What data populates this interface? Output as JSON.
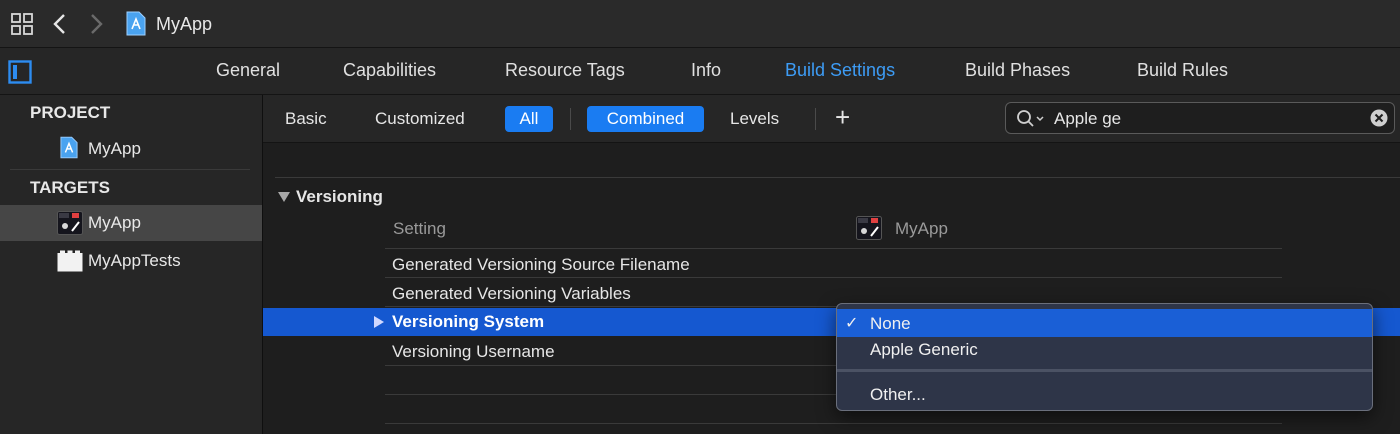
{
  "app": {
    "title": "MyApp"
  },
  "tabs": [
    "General",
    "Capabilities",
    "Resource Tags",
    "Info",
    "Build Settings",
    "Build Phases",
    "Build Rules"
  ],
  "sidebar": {
    "project_header": "PROJECT",
    "project_item": "MyApp",
    "targets_header": "TARGETS",
    "targets": [
      "MyApp",
      "MyAppTests"
    ]
  },
  "filters": {
    "basic": "Basic",
    "customized": "Customized",
    "all": "All",
    "combined": "Combined",
    "levels": "Levels",
    "add": "+"
  },
  "search": {
    "value": "Apple ge"
  },
  "settings": {
    "section": "Versioning",
    "col_setting": "Setting",
    "col_target": "MyApp",
    "rows": [
      "Generated Versioning Source Filename",
      "Generated Versioning Variables",
      "Versioning System",
      "Versioning Username"
    ]
  },
  "popup": {
    "check": "✓",
    "items": [
      "None",
      "Apple Generic",
      "Other..."
    ]
  },
  "colors": {
    "accent": "#1a7cf2",
    "tab_active": "#3d9cf5",
    "selection": "#1558d0"
  }
}
